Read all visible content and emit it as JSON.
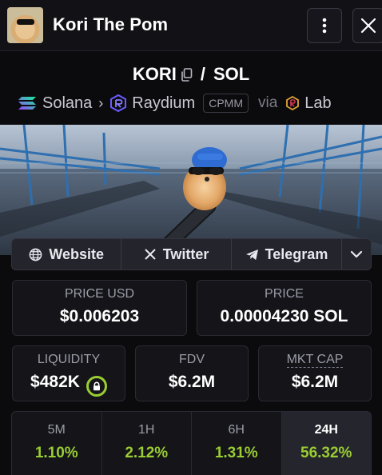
{
  "header": {
    "title": "Kori The Pom"
  },
  "pair": {
    "base": "KORI",
    "separator": "/",
    "quote": "SOL"
  },
  "route": {
    "chain": "Solana",
    "dex": "Raydium",
    "pool_type": "CPMM",
    "via_label": "via",
    "launchpad": "Lab"
  },
  "links": {
    "website": "Website",
    "twitter": "Twitter",
    "telegram": "Telegram"
  },
  "stats": {
    "price_usd_label": "PRICE USD",
    "price_usd": "$0.006203",
    "price_label": "PRICE",
    "price": "0.00004230 SOL",
    "liquidity_label": "LIQUIDITY",
    "liquidity": "$482K",
    "fdv_label": "FDV",
    "fdv": "$6.2M",
    "mktcap_label": "MKT CAP",
    "mktcap": "$6.2M"
  },
  "periods": [
    {
      "label": "5M",
      "value": "1.10%"
    },
    {
      "label": "1H",
      "value": "2.12%"
    },
    {
      "label": "6H",
      "value": "1.31%"
    },
    {
      "label": "24H",
      "value": "56.32%"
    }
  ],
  "colors": {
    "positive": "#9acd32",
    "solana_gradient": [
      "#9945ff",
      "#14f195"
    ],
    "raydium": "#6b5cff"
  },
  "icons": [
    "more-vertical-icon",
    "close-icon",
    "copy-icon",
    "solana-icon",
    "chevron-right-icon",
    "raydium-icon",
    "launchpad-icon",
    "globe-icon",
    "x-icon",
    "telegram-icon",
    "chevron-down-icon",
    "lock-icon"
  ]
}
